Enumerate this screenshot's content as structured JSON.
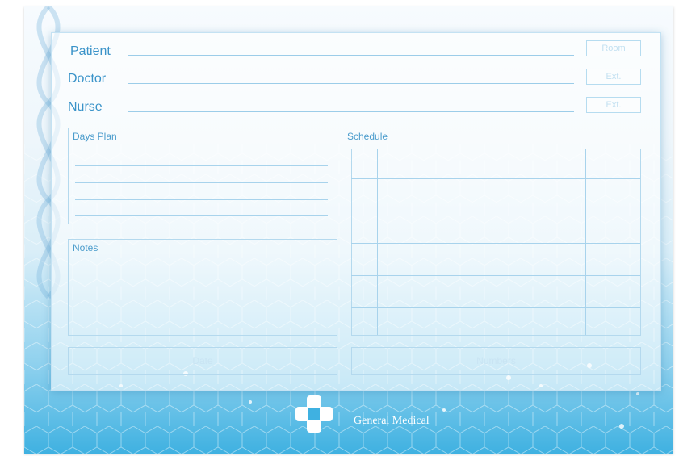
{
  "form": {
    "patient_label": "Patient",
    "doctor_label": "Doctor",
    "nurse_label": "Nurse",
    "room_label": "Room",
    "ext_label_1": "Ext.",
    "ext_label_2": "Ext.",
    "days_plan_title": "Days Plan",
    "notes_title": "Notes",
    "schedule_title": "Schedule",
    "date_label": "Date",
    "numbers_label": "Numbers"
  },
  "brand": {
    "name": "General Medical"
  },
  "colors": {
    "accent": "#3a93c9",
    "line": "#9ccde9",
    "footer_blue": "#3fb1e1"
  }
}
